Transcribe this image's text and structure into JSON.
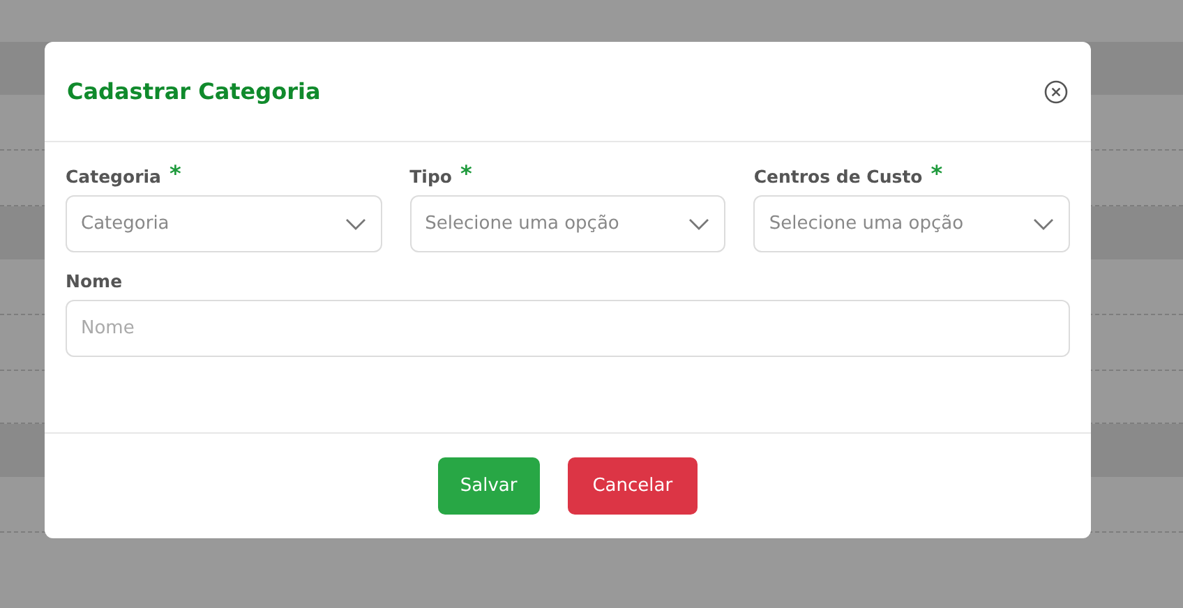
{
  "modal": {
    "title": "Cadastrar Categoria"
  },
  "fields": [
    {
      "kind": "select",
      "label": "Categoria",
      "required": true,
      "placeholder": "Categoria"
    },
    {
      "kind": "select",
      "label": "Tipo",
      "required": true,
      "placeholder": "Selecione uma opção"
    },
    {
      "kind": "select",
      "label": "Centros de Custo",
      "required": true,
      "placeholder": "Selecione uma opção"
    },
    {
      "kind": "text",
      "label": "Nome",
      "required": false,
      "placeholder": "Nome"
    }
  ],
  "required_mark": "*",
  "buttons": [
    {
      "kind": "success",
      "label": "Salvar"
    },
    {
      "kind": "danger",
      "label": "Cancelar"
    }
  ]
}
